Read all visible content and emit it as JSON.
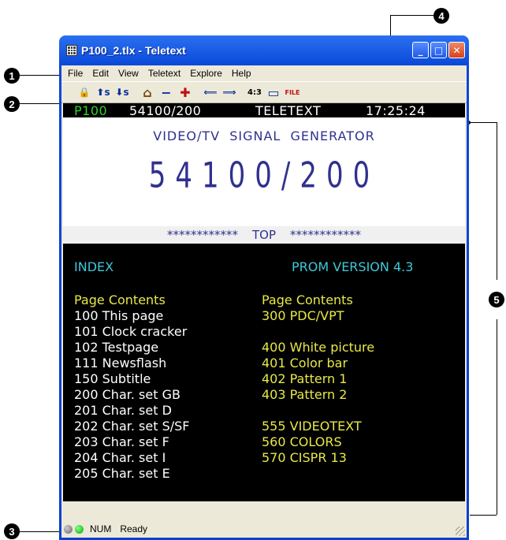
{
  "window": {
    "title": "P100_2.tlx - Teletext",
    "minimize": "_",
    "maximize": "□",
    "close": "✕"
  },
  "menu": [
    "File",
    "Edit",
    "View",
    "Teletext",
    "Explore",
    "Help"
  ],
  "toolbar": [
    {
      "icon": "lock-icon",
      "glyph": "🔒"
    },
    {
      "icon": "subpage-up-icon",
      "glyph": "⬆s"
    },
    {
      "icon": "subpage-down-icon",
      "glyph": "⬇s"
    },
    {
      "icon": "home-icon",
      "glyph": "⌂"
    },
    {
      "icon": "minus-icon",
      "glyph": "−"
    },
    {
      "icon": "plus-icon",
      "glyph": "✚"
    },
    {
      "icon": "arrow-left-icon",
      "glyph": "⟸"
    },
    {
      "icon": "arrow-right-icon",
      "glyph": "⟹"
    },
    {
      "icon": "aspect-4-3-icon",
      "glyph": "4:3"
    },
    {
      "icon": "window-icon",
      "glyph": "▭"
    },
    {
      "icon": "file-icon",
      "glyph": "FILE"
    }
  ],
  "teletext": {
    "header": {
      "page": "P100",
      "subpage": "54100/200",
      "service": "TELETEXT",
      "time": "17:25:24"
    },
    "banner": {
      "line1": "VIDEO/TV  SIGNAL  GENERATOR",
      "line2": "54100/200",
      "line3_left": "************",
      "line3_mid": "TOP",
      "line3_right": "************"
    },
    "index_title": "INDEX",
    "prom_version": "PROM VERSION 4.3",
    "left_header": "Page Contents",
    "right_header": "Page Contents",
    "left_rows": [
      "100 This page",
      "101 Clock cracker",
      "102 Testpage",
      "111 Newsflash",
      "150 Subtitle",
      "200 Char. set GB",
      "201 Char. set D",
      "202 Char. set S/SF",
      "203 Char. set F",
      "204 Char. set I",
      "205 Char. set E"
    ],
    "right_rows": [
      "300 PDC/VPT",
      "",
      "400 White picture",
      "401 Color bar",
      "402 Pattern 1",
      "403 Pattern 2",
      "",
      "555 VIDEOTEXT",
      "560 COLORS",
      "570 CISPR 13",
      ""
    ]
  },
  "status": {
    "num": "NUM",
    "text": "Ready"
  },
  "callouts": [
    "1",
    "2",
    "3",
    "4",
    "5"
  ],
  "colors": {
    "titlebar": "#0a3fd0",
    "close": "#d8421c",
    "header_page": "#30d030",
    "cyan": "#40c8d8",
    "yellow": "#e8e848",
    "banner_text": "#303090"
  }
}
